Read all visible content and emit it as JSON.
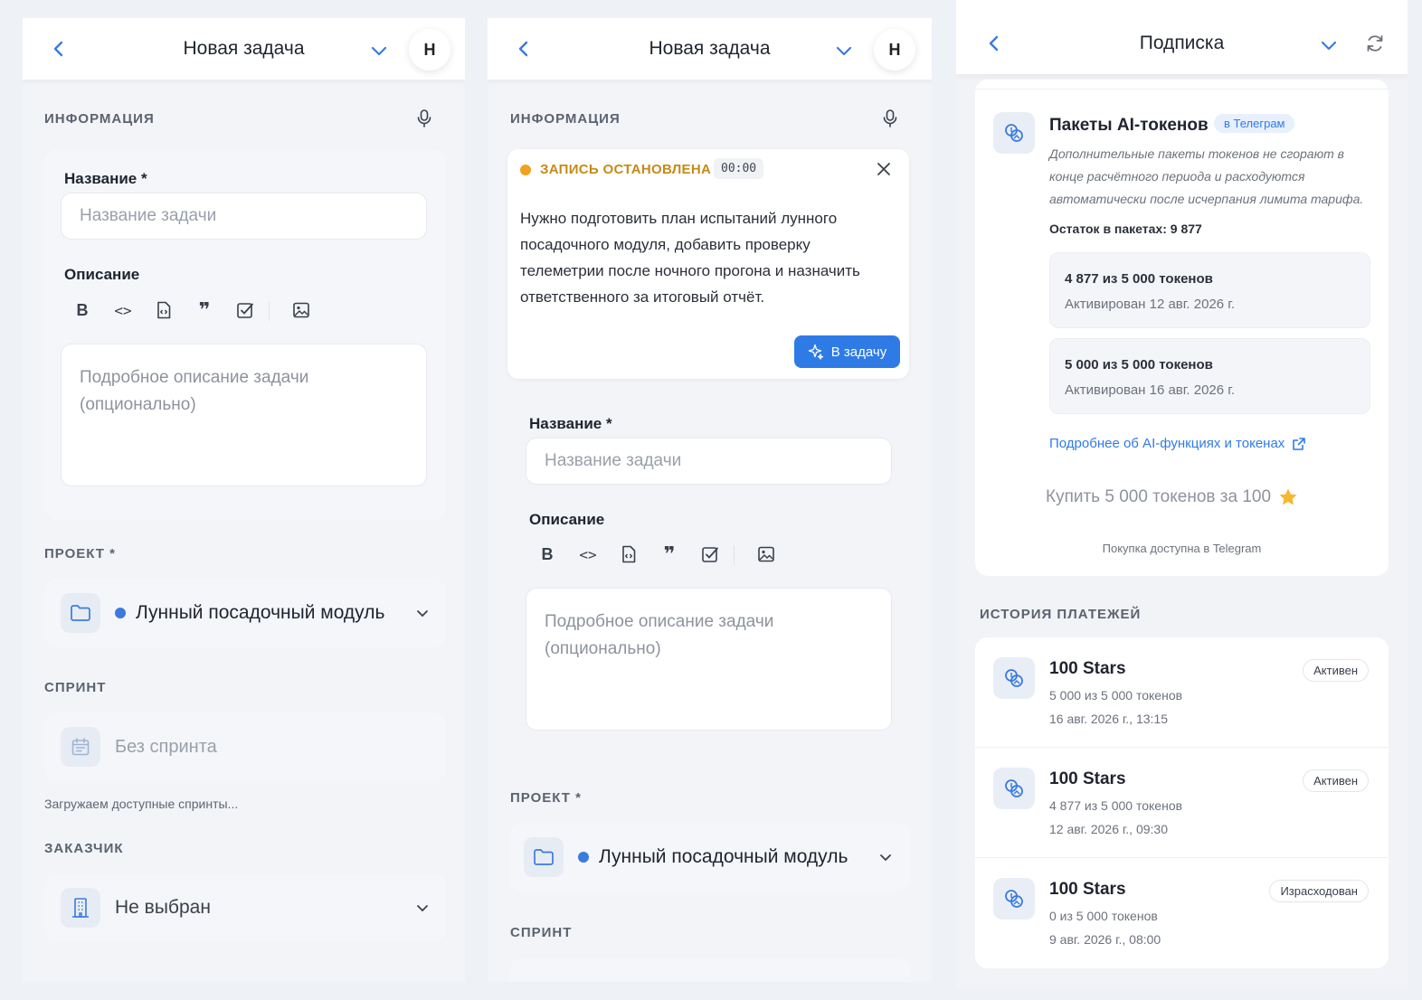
{
  "panel1": {
    "title": "Новая задача",
    "avatar": "Н",
    "info_label": "ИНФОРМАЦИЯ",
    "name_label": "Название *",
    "name_placeholder": "Название задачи",
    "desc_label": "Описание",
    "desc_placeholder": "Подробное описание задачи (опционально)",
    "project_label": "ПРОЕКТ *",
    "project_value": "Лунный посадочный модуль",
    "sprint_label": "СПРИНТ",
    "sprint_value": "Без спринта",
    "sprint_note": "Загружаем доступные спринты...",
    "client_label": "ЗАКАЗЧИК",
    "client_value": "Не выбран"
  },
  "panel2": {
    "title": "Новая задача",
    "avatar": "Н",
    "info_label": "ИНФОРМАЦИЯ",
    "rec_status": "ЗАПИСЬ ОСТАНОВЛЕНА",
    "rec_time": "00:00",
    "transcript": "Нужно подготовить план испытаний лунного посадочного модуля, добавить проверку телеметрии после ночного прогона и назначить ответственного за итоговый отчёт.",
    "to_task_button": "В задачу",
    "name_label": "Название *",
    "name_placeholder": "Название задачи",
    "desc_label": "Описание",
    "desc_placeholder": "Подробное описание задачи (опционально)",
    "project_label": "ПРОЕКТ *",
    "project_value": "Лунный посадочный модуль",
    "sprint_label": "СПРИНТ"
  },
  "panel3": {
    "title": "Подписка",
    "packages": {
      "title": "Пакеты AI-токенов",
      "badge": "в Телеграм",
      "description": "Дополнительные пакеты токенов не сгорают в конце расчётного периода и расходуются автоматически после исчерпания лимита тарифа.",
      "remaining": "Остаток в пакетах: 9 877",
      "items": [
        {
          "amount": "4 877 из 5 000 токенов",
          "activated": "Активирован 12 авг. 2026 г."
        },
        {
          "amount": "5 000 из 5 000 токенов",
          "activated": "Активирован 16 авг. 2026 г."
        }
      ],
      "more_link": "Подробнее об AI-функциях и токенах",
      "buy_label": "Купить 5 000 токенов за 100",
      "buy_note": "Покупка доступна в Telegram"
    },
    "history_label": "ИСТОРИЯ ПЛАТЕЖЕЙ",
    "history": [
      {
        "title": "100 Stars",
        "tokens": "5 000 из 5 000 токенов",
        "date": "16 авг. 2026 г., 13:15",
        "status": "Активен"
      },
      {
        "title": "100 Stars",
        "tokens": "4 877 из 5 000 токенов",
        "date": "12 авг. 2026 г., 09:30",
        "status": "Активен"
      },
      {
        "title": "100 Stars",
        "tokens": "0 из 5 000 токенов",
        "date": "9 авг. 2026 г., 08:00",
        "status": "Израсходован"
      }
    ]
  },
  "colors": {
    "accent": "#2f7be6",
    "project_dot": "#3a7bde",
    "recording_status": "#c68a17",
    "star": "#f5b82e"
  }
}
